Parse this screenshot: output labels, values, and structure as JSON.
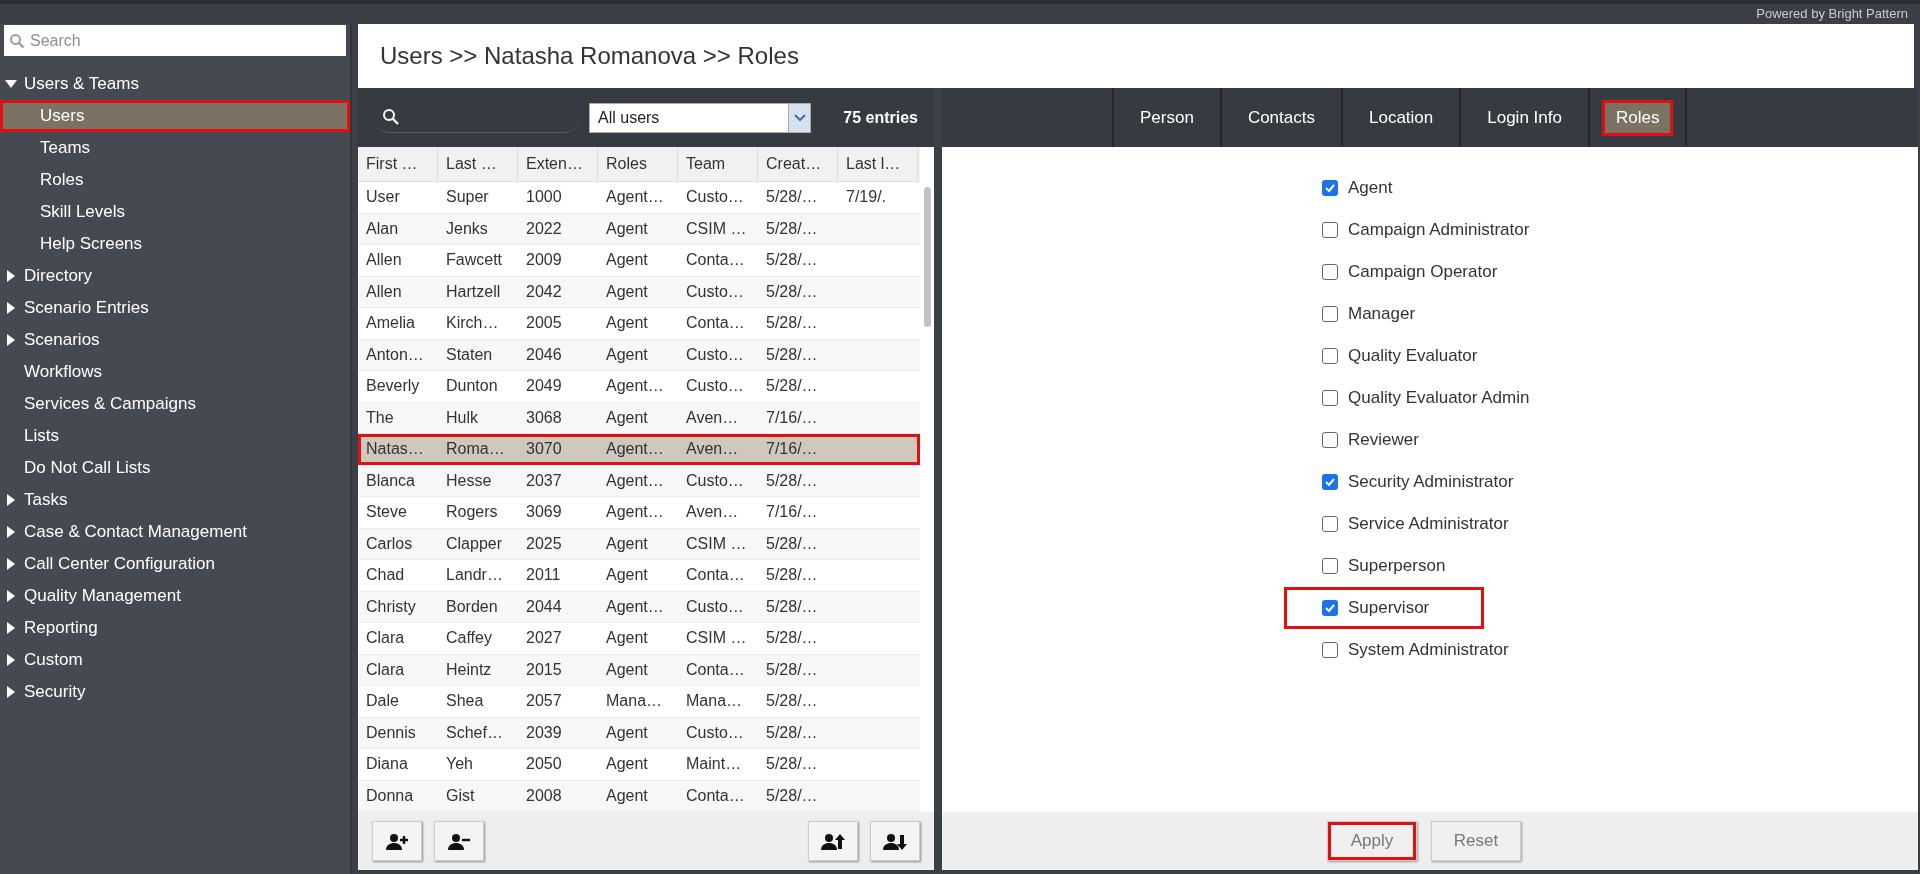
{
  "top_bar": {
    "branding": "Powered by Bright Pattern"
  },
  "sidebar": {
    "search": {
      "placeholder": "Search"
    },
    "items": [
      {
        "label": "Users & Teams",
        "kind": "folder",
        "expanded": true,
        "selected": false,
        "outlined": false,
        "children": [
          {
            "label": "Users",
            "kind": "leaf",
            "selected": true,
            "outlined": true
          },
          {
            "label": "Teams",
            "kind": "leaf",
            "selected": false,
            "outlined": false
          },
          {
            "label": "Roles",
            "kind": "leaf",
            "selected": false,
            "outlined": false
          },
          {
            "label": "Skill Levels",
            "kind": "leaf",
            "selected": false,
            "outlined": false
          },
          {
            "label": "Help Screens",
            "kind": "leaf",
            "selected": false,
            "outlined": false
          }
        ]
      },
      {
        "label": "Directory",
        "kind": "folder",
        "expanded": false,
        "selected": false,
        "outlined": false
      },
      {
        "label": "Scenario Entries",
        "kind": "folder",
        "expanded": false,
        "selected": false,
        "outlined": false
      },
      {
        "label": "Scenarios",
        "kind": "folder",
        "expanded": false,
        "selected": false,
        "outlined": false
      },
      {
        "label": "Workflows",
        "kind": "leaf",
        "selected": false,
        "outlined": false
      },
      {
        "label": "Services & Campaigns",
        "kind": "leaf",
        "selected": false,
        "outlined": false
      },
      {
        "label": "Lists",
        "kind": "leaf",
        "selected": false,
        "outlined": false
      },
      {
        "label": "Do Not Call Lists",
        "kind": "leaf",
        "selected": false,
        "outlined": false
      },
      {
        "label": "Tasks",
        "kind": "folder",
        "expanded": false,
        "selected": false,
        "outlined": false
      },
      {
        "label": "Case & Contact Management",
        "kind": "folder",
        "expanded": false,
        "selected": false,
        "outlined": false
      },
      {
        "label": "Call Center Configuration",
        "kind": "folder",
        "expanded": false,
        "selected": false,
        "outlined": false
      },
      {
        "label": "Quality Management",
        "kind": "folder",
        "expanded": false,
        "selected": false,
        "outlined": false
      },
      {
        "label": "Reporting",
        "kind": "folder",
        "expanded": false,
        "selected": false,
        "outlined": false
      },
      {
        "label": "Custom",
        "kind": "folder",
        "expanded": false,
        "selected": false,
        "outlined": false
      },
      {
        "label": "Security",
        "kind": "folder",
        "expanded": false,
        "selected": false,
        "outlined": false
      }
    ]
  },
  "breadcrumb": "Users >> Natasha Romanova >> Roles",
  "users_list": {
    "filter": "All users",
    "count": "75 entries",
    "columns": [
      "First …",
      "Last …",
      "Exten…",
      "Roles",
      "Team",
      "Creat…",
      "Last l…"
    ],
    "rows": [
      {
        "cells": [
          "User",
          "Super",
          "1000",
          "Agent…",
          "Custo…",
          "5/28/…",
          "7/19/."
        ],
        "selected": false,
        "outlined": false
      },
      {
        "cells": [
          "Alan",
          "Jenks",
          "2022",
          "Agent",
          "CSIM …",
          "5/28/…"
        ],
        "selected": false,
        "outlined": false
      },
      {
        "cells": [
          "Allen",
          "Fawcett",
          "2009",
          "Agent",
          "Conta…",
          "5/28/…"
        ],
        "selected": false,
        "outlined": false
      },
      {
        "cells": [
          "Allen",
          "Hartzell",
          "2042",
          "Agent",
          "Custo…",
          "5/28/…"
        ],
        "selected": false,
        "outlined": false
      },
      {
        "cells": [
          "Amelia",
          "Kirch…",
          "2005",
          "Agent",
          "Conta…",
          "5/28/…"
        ],
        "selected": false,
        "outlined": false
      },
      {
        "cells": [
          "Anton…",
          "Staten",
          "2046",
          "Agent",
          "Custo…",
          "5/28/…"
        ],
        "selected": false,
        "outlined": false
      },
      {
        "cells": [
          "Beverly",
          "Dunton",
          "2049",
          "Agent…",
          "Custo…",
          "5/28/…"
        ],
        "selected": false,
        "outlined": false
      },
      {
        "cells": [
          "The",
          "Hulk",
          "3068",
          "Agent",
          "Aven…",
          "7/16/…"
        ],
        "selected": false,
        "outlined": false
      },
      {
        "cells": [
          "Natas…",
          "Roma…",
          "3070",
          "Agent…",
          "Aven…",
          "7/16/…"
        ],
        "selected": true,
        "outlined": true
      },
      {
        "cells": [
          "Blanca",
          "Hesse",
          "2037",
          "Agent…",
          "Custo…",
          "5/28/…"
        ],
        "selected": false,
        "outlined": false
      },
      {
        "cells": [
          "Steve",
          "Rogers",
          "3069",
          "Agent…",
          "Aven…",
          "7/16/…"
        ],
        "selected": false,
        "outlined": false
      },
      {
        "cells": [
          "Carlos",
          "Clapper",
          "2025",
          "Agent",
          "CSIM …",
          "5/28/…"
        ],
        "selected": false,
        "outlined": false
      },
      {
        "cells": [
          "Chad",
          "Landr…",
          "2011",
          "Agent",
          "Conta…",
          "5/28/…"
        ],
        "selected": false,
        "outlined": false
      },
      {
        "cells": [
          "Christy",
          "Borden",
          "2044",
          "Agent…",
          "Custo…",
          "5/28/…"
        ],
        "selected": false,
        "outlined": false
      },
      {
        "cells": [
          "Clara",
          "Caffey",
          "2027",
          "Agent",
          "CSIM …",
          "5/28/…"
        ],
        "selected": false,
        "outlined": false
      },
      {
        "cells": [
          "Clara",
          "Heintz",
          "2015",
          "Agent",
          "Conta…",
          "5/28/…"
        ],
        "selected": false,
        "outlined": false
      },
      {
        "cells": [
          "Dale",
          "Shea",
          "2057",
          "Mana…",
          "Mana…",
          "5/28/…"
        ],
        "selected": false,
        "outlined": false
      },
      {
        "cells": [
          "Dennis",
          "Schef…",
          "2039",
          "Agent",
          "Custo…",
          "5/28/…"
        ],
        "selected": false,
        "outlined": false
      },
      {
        "cells": [
          "Diana",
          "Yeh",
          "2050",
          "Agent",
          "Maint…",
          "5/28/…"
        ],
        "selected": false,
        "outlined": false
      },
      {
        "cells": [
          "Donna",
          "Gist",
          "2008",
          "Agent",
          "Conta…",
          "5/28/…"
        ],
        "selected": false,
        "outlined": false
      }
    ],
    "actions": [
      {
        "kind": "add"
      },
      {
        "kind": "remove"
      },
      {
        "kind": "import"
      },
      {
        "kind": "export"
      }
    ]
  },
  "tabs": [
    {
      "label": "Person",
      "selected": false,
      "outlined": false
    },
    {
      "label": "Contacts",
      "selected": false,
      "outlined": false
    },
    {
      "label": "Location",
      "selected": false,
      "outlined": false
    },
    {
      "label": "Login Info",
      "selected": false,
      "outlined": false
    },
    {
      "label": "Roles",
      "selected": true,
      "outlined": true
    }
  ],
  "roles": [
    {
      "label": "Agent",
      "checked": true,
      "outlined": false
    },
    {
      "label": "Campaign Administrator",
      "checked": false,
      "outlined": false
    },
    {
      "label": "Campaign Operator",
      "checked": false,
      "outlined": false
    },
    {
      "label": "Manager",
      "checked": false,
      "outlined": false
    },
    {
      "label": "Quality Evaluator",
      "checked": false,
      "outlined": false
    },
    {
      "label": "Quality Evaluator Admin",
      "checked": false,
      "outlined": false
    },
    {
      "label": "Reviewer",
      "checked": false,
      "outlined": false
    },
    {
      "label": "Security Administrator",
      "checked": true,
      "outlined": false
    },
    {
      "label": "Service Administrator",
      "checked": false,
      "outlined": false
    },
    {
      "label": "Superperson",
      "checked": false,
      "outlined": false
    },
    {
      "label": "Supervisor",
      "checked": true,
      "outlined": true
    },
    {
      "label": "System Administrator",
      "checked": false,
      "outlined": false
    }
  ],
  "buttons": [
    {
      "label": "Apply",
      "outlined": true
    },
    {
      "label": "Reset",
      "outlined": false
    }
  ]
}
